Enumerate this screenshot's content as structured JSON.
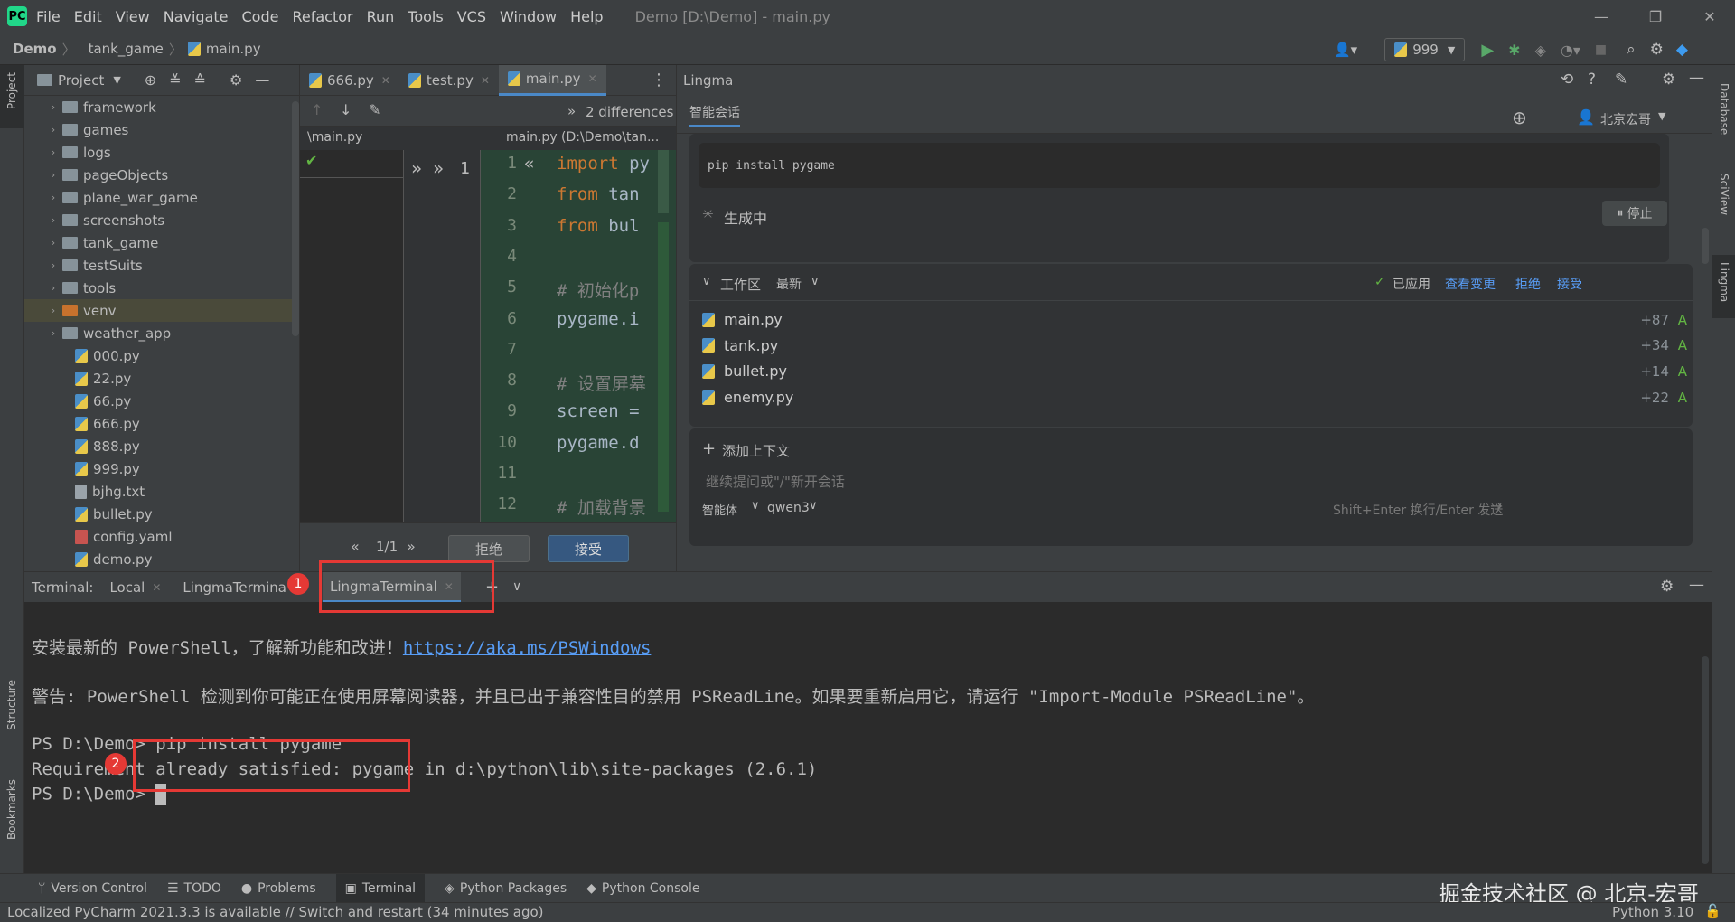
{
  "menubar": {
    "items": [
      "File",
      "Edit",
      "View",
      "Navigate",
      "Code",
      "Refactor",
      "Run",
      "Tools",
      "VCS",
      "Window",
      "Help"
    ],
    "window_title": "Demo [D:\\Demo] - main.py"
  },
  "navbar": {
    "crumbs": [
      "Demo",
      "tank_game",
      "main.py"
    ],
    "run_config": "999"
  },
  "left_stripe": {
    "project": "Project",
    "structure": "Structure",
    "bookmarks": "Bookmarks"
  },
  "right_stripe": {
    "database": "Database",
    "sciview": "SciView",
    "lingma": "Lingma"
  },
  "project": {
    "title": "Project",
    "items": [
      {
        "label": "framework",
        "type": "folder"
      },
      {
        "label": "games",
        "type": "folder"
      },
      {
        "label": "logs",
        "type": "folder"
      },
      {
        "label": "pageObjects",
        "type": "folder"
      },
      {
        "label": "plane_war_game",
        "type": "folder"
      },
      {
        "label": "screenshots",
        "type": "folder"
      },
      {
        "label": "tank_game",
        "type": "folder"
      },
      {
        "label": "testSuits",
        "type": "folder"
      },
      {
        "label": "tools",
        "type": "folder"
      },
      {
        "label": "venv",
        "type": "folder-orange"
      },
      {
        "label": "weather_app",
        "type": "folder"
      },
      {
        "label": "000.py",
        "type": "py"
      },
      {
        "label": "22.py",
        "type": "py"
      },
      {
        "label": "66.py",
        "type": "py"
      },
      {
        "label": "666.py",
        "type": "py"
      },
      {
        "label": "888.py",
        "type": "py"
      },
      {
        "label": "999.py",
        "type": "py"
      },
      {
        "label": "bjhg.txt",
        "type": "txt"
      },
      {
        "label": "bullet.py",
        "type": "py"
      },
      {
        "label": "config.yaml",
        "type": "yaml"
      },
      {
        "label": "demo.py",
        "type": "py"
      }
    ]
  },
  "editor": {
    "tabs": [
      "666.py",
      "test.py",
      "main.py"
    ],
    "differences": "2 differences",
    "left_header": "\\main.py",
    "right_header": "main.py (D:\\Demo\\tan...",
    "mid_counter": "1",
    "lines": [
      {
        "n": "1",
        "parts": [
          {
            "t": "import ",
            "c": "kw"
          },
          {
            "t": "py",
            "c": ""
          }
        ]
      },
      {
        "n": "2",
        "parts": [
          {
            "t": "from ",
            "c": "kw"
          },
          {
            "t": "tan",
            "c": ""
          }
        ]
      },
      {
        "n": "3",
        "parts": [
          {
            "t": "from ",
            "c": "kw"
          },
          {
            "t": "bul",
            "c": ""
          }
        ]
      },
      {
        "n": "4",
        "parts": []
      },
      {
        "n": "5",
        "parts": [
          {
            "t": "# 初始化p",
            "c": "cm"
          }
        ]
      },
      {
        "n": "6",
        "parts": [
          {
            "t": "pygame.i",
            "c": ""
          }
        ]
      },
      {
        "n": "7",
        "parts": []
      },
      {
        "n": "8",
        "parts": [
          {
            "t": "# 设置屏幕",
            "c": "cm"
          }
        ]
      },
      {
        "n": "9",
        "parts": [
          {
            "t": "screen =",
            "c": ""
          }
        ]
      },
      {
        "n": "10",
        "parts": [
          {
            "t": "pygame.d",
            "c": ""
          }
        ]
      },
      {
        "n": "11",
        "parts": []
      },
      {
        "n": "12",
        "parts": [
          {
            "t": "# 加载背景",
            "c": "cm"
          }
        ]
      }
    ],
    "pager": "1/1",
    "reject": "拒绝",
    "accept": "接受"
  },
  "lingma": {
    "title": "Lingma",
    "subtitle": "智能会话",
    "user": "北京宏哥",
    "cmd": "pip install pygame",
    "generating": "生成中",
    "stop": "停止",
    "workspace": {
      "title": "工作区",
      "sort": "最新",
      "applied": "已应用",
      "view_changes": "查看变更",
      "reject": "拒绝",
      "accept": "接受",
      "files": [
        {
          "name": "main.py",
          "add": "+87",
          "flag": "A"
        },
        {
          "name": "tank.py",
          "add": "+34",
          "flag": "A"
        },
        {
          "name": "bullet.py",
          "add": "+14",
          "flag": "A"
        },
        {
          "name": "enemy.py",
          "add": "+22",
          "flag": "A"
        }
      ]
    },
    "add_context": "添加上下文",
    "placeholder": "继续提问或\"/\"新开会话",
    "agent": "智能体",
    "model": "qwen3",
    "send_hint": "Shift+Enter 换行/Enter 发送"
  },
  "terminal": {
    "label": "Terminal:",
    "tabs": [
      "Local",
      "LingmaTermina",
      "LingmaTerminal"
    ],
    "lines": {
      "l1_text": "安装最新的 PowerShell，了解新功能和改进！",
      "l1_link": "https://aka.ms/PSWindows",
      "l2": "警告: PowerShell 检测到你可能正在使用屏幕阅读器，并且已出于兼容性目的禁用 PSReadLine。如果要重新启用它，请运行 \"Import-Module PSReadLine\"。",
      "l3_prompt": "PS D:\\Demo> ",
      "l3_cmd": "pip install pygame",
      "l4": "Requirement already satisfied: pygame in d:\\python\\lib\\site-packages (2.6.1)",
      "l5": "PS D:\\Demo> "
    }
  },
  "toolwindows": [
    "Version Control",
    "TODO",
    "Problems",
    "Terminal",
    "Python Packages",
    "Python Console"
  ],
  "status": {
    "message": "Localized PyCharm 2021.3.3 is available // Switch and restart (34 minutes ago)",
    "interpreter": "Python 3.10",
    "watermark": "掘金技术社区 @ 北京-宏哥"
  },
  "annotations": {
    "badge1": "1",
    "badge2": "2"
  },
  "colors": {
    "annotation": "#e53935",
    "accent": "#4a88c7",
    "diff_green": "#294436"
  }
}
